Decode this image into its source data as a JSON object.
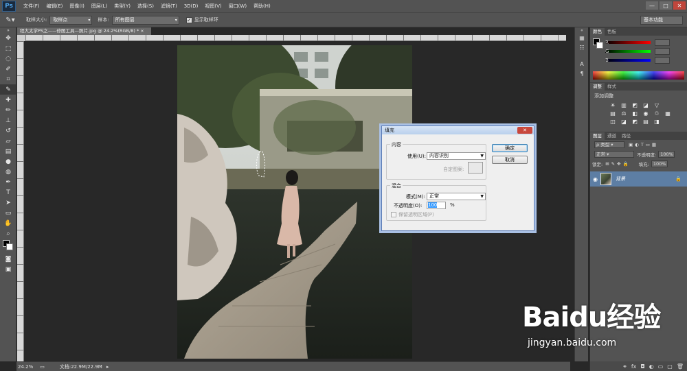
{
  "app": {
    "logo": "Ps"
  },
  "menu": [
    "文件(F)",
    "编辑(E)",
    "图像(I)",
    "图层(L)",
    "类型(Y)",
    "选择(S)",
    "滤镜(T)",
    "3D(D)",
    "视图(V)",
    "窗口(W)",
    "帮助(H)"
  ],
  "window_controls": {
    "minimize": "—",
    "maximize": "□",
    "close": "✕"
  },
  "options": {
    "sample_size_label": "取样大小:",
    "sample_size_value": "取样点",
    "sample_label": "样本:",
    "sample_value": "所有图层",
    "show_ring_label": "显示取样环",
    "show_ring_checked": true,
    "workspace": "基本功能"
  },
  "document": {
    "tab_title": "程大太学PS之——修图工具—照片.jpg @ 24.2%(RGB/8) *",
    "tab_close": "×"
  },
  "status": {
    "zoom": "24.2%",
    "doc_info": "文档:22.9M/22.9M"
  },
  "tools": [
    "move-icon",
    "marquee-icon",
    "lasso-icon",
    "quick-select-icon",
    "crop-icon",
    "eyedropper-icon",
    "healing-icon",
    "brush-icon",
    "stamp-icon",
    "history-brush-icon",
    "eraser-icon",
    "gradient-icon",
    "blur-icon",
    "dodge-icon",
    "pen-icon",
    "type-icon",
    "path-select-icon",
    "shape-icon",
    "hand-icon",
    "zoom-icon"
  ],
  "colors": {
    "foreground": "#000000",
    "background": "#ffffff",
    "accent": "#5d7ea4"
  },
  "panels": {
    "color_tabs": [
      "颜色",
      "色板"
    ],
    "rgb_labels": [
      "R",
      "G",
      "B"
    ],
    "adjust_tabs": [
      "调整",
      "样式"
    ],
    "adjust_title": "添加调整",
    "layers_tabs": [
      "图层",
      "通道",
      "路径"
    ],
    "kind_label": "类型",
    "blend_mode": "正常",
    "opacity_label": "不透明度:",
    "opacity_value": "100%",
    "lock_label": "锁定:",
    "fill_label": "填充:",
    "fill_value": "100%",
    "layer_name": "背景"
  },
  "dialog": {
    "title": "填充",
    "close": "✕",
    "content_group": "内容",
    "use_label": "使用(U):",
    "use_value": "内容识别",
    "custom_pattern_label": "自定图案:",
    "blend_group": "混合",
    "mode_label": "模式(M):",
    "mode_value": "正常",
    "opacity_label": "不透明度(O):",
    "opacity_value": "100",
    "percent": "%",
    "preserve_label": "保留透明区域(P)",
    "ok": "确定",
    "cancel": "取消"
  },
  "watermark": {
    "logo": "Baidu经验",
    "url": "jingyan.baidu.com"
  }
}
